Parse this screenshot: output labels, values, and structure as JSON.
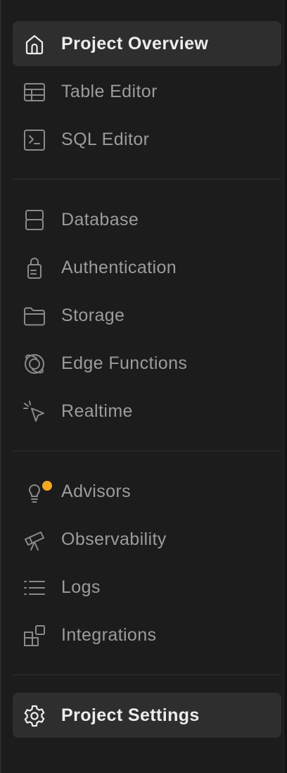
{
  "colors": {
    "background": "#1c1c1c",
    "active_item_bg": "#2e2e2e",
    "text_active": "#ededed",
    "text_inactive": "#9c9c9c",
    "icon_inactive": "#8a8a8a",
    "badge": "#f5a623"
  },
  "nav": {
    "group1": [
      {
        "label": "Project Overview",
        "icon": "home-icon",
        "active": true
      },
      {
        "label": "Table Editor",
        "icon": "table-icon"
      },
      {
        "label": "SQL Editor",
        "icon": "terminal-icon"
      }
    ],
    "group2": [
      {
        "label": "Database",
        "icon": "database-icon"
      },
      {
        "label": "Authentication",
        "icon": "lock-icon"
      },
      {
        "label": "Storage",
        "icon": "folder-icon"
      },
      {
        "label": "Edge Functions",
        "icon": "globe-icon"
      },
      {
        "label": "Realtime",
        "icon": "pointer-icon"
      }
    ],
    "group3": [
      {
        "label": "Advisors",
        "icon": "lightbulb-icon",
        "badge": true
      },
      {
        "label": "Observability",
        "icon": "telescope-icon"
      },
      {
        "label": "Logs",
        "icon": "list-icon"
      },
      {
        "label": "Integrations",
        "icon": "blocks-icon"
      }
    ],
    "footer": [
      {
        "label": "Project Settings",
        "icon": "gear-icon",
        "active": true
      }
    ]
  }
}
